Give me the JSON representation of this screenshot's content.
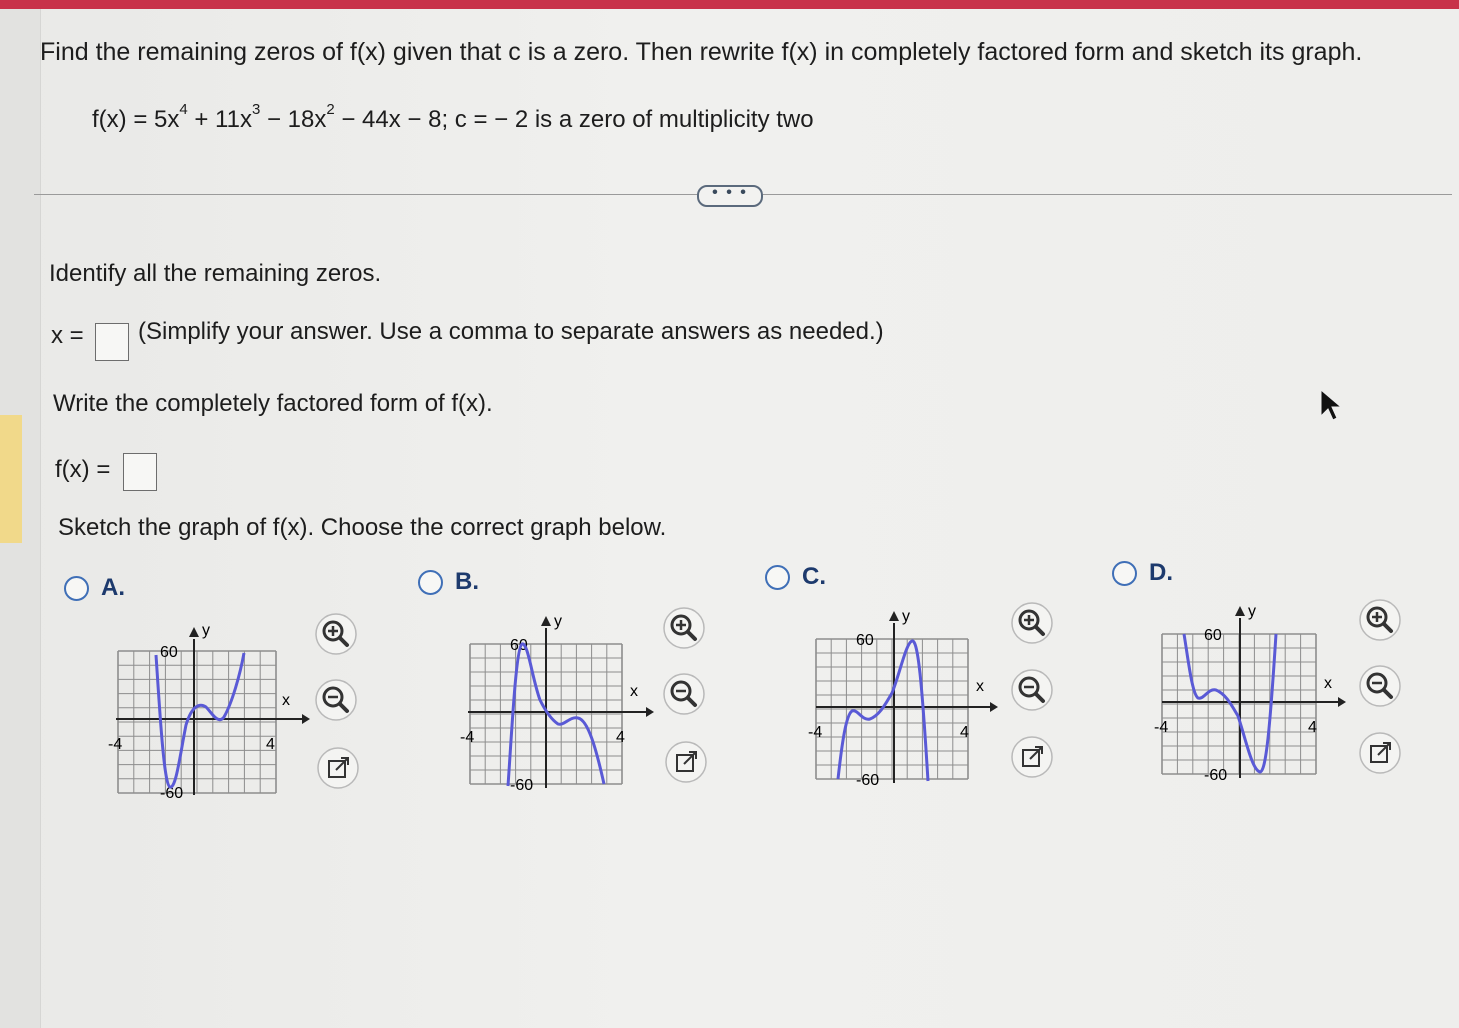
{
  "question": {
    "prompt": "Find the remaining zeros of f(x) given that c is a zero. Then rewrite f(x) in completely factored form and sketch its graph.",
    "eq_part1": "f(x) = 5x",
    "eq_exp1": "4",
    "eq_part2": " + 11x",
    "eq_exp2": "3",
    "eq_part3": " − 18x",
    "eq_exp3": "2",
    "eq_part4": " − 44x − 8; c = − 2 is a zero of multiplicity two"
  },
  "more_button_label": "• • •",
  "part1": {
    "label": "Identify all the remaining zeros.",
    "prefix": "x =",
    "hint": "(Simplify your answer. Use a comma to separate answers as needed.)",
    "value": ""
  },
  "part2": {
    "label": "Write the completely factored form of f(x).",
    "prefix": "f(x) =",
    "value": ""
  },
  "part3": {
    "label": "Sketch the graph of f(x). Choose the correct graph below."
  },
  "options": [
    {
      "label": "A.",
      "y_top": "60",
      "y_bottom": "-60",
      "x_left": "-4",
      "x_right": "4",
      "x_axis": "x",
      "y_axis": "y"
    },
    {
      "label": "B.",
      "y_top": "60",
      "y_bottom": "-60",
      "x_left": "-4",
      "x_right": "4",
      "x_axis": "x",
      "y_axis": "y"
    },
    {
      "label": "C.",
      "y_top": "60",
      "y_bottom": "-60",
      "x_left": "-4",
      "x_right": "4",
      "x_axis": "x",
      "y_axis": "y"
    },
    {
      "label": "D.",
      "y_top": "60",
      "y_bottom": "-60",
      "x_left": "-4",
      "x_right": "4",
      "x_axis": "x",
      "y_axis": "y"
    }
  ],
  "icons": [
    "zoom-in-icon",
    "zoom-out-icon",
    "open-new-window-icon"
  ],
  "colors": {
    "accent_bar": "#c8324a",
    "radio": "#3f6fb7",
    "curve": "#5a5ad6",
    "option_label": "#1d3a6d"
  }
}
